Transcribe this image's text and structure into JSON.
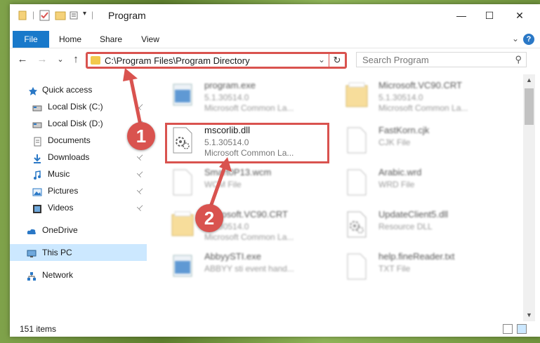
{
  "window": {
    "title": "Program",
    "minimize": "—",
    "maximize": "☐",
    "close": "✕"
  },
  "ribbon": {
    "tabs": [
      "File",
      "Home",
      "Share",
      "View"
    ],
    "help": "?",
    "collapse": "⌄"
  },
  "nav": {
    "back": "←",
    "forward": "→",
    "recent": "⌄",
    "up": "↑",
    "address": "C:\\Program Files\\Program Directory",
    "address_dropdown": "⌄",
    "refresh": "↻",
    "search_placeholder": "Search Program",
    "search_icon": "⚲"
  },
  "sidebar": {
    "items": [
      {
        "label": "Quick access",
        "icon": "star-icon",
        "pinned": false
      },
      {
        "label": "Local Disk (C:)",
        "icon": "drive-icon",
        "pinned": true
      },
      {
        "label": "Local Disk (D:)",
        "icon": "drive-icon",
        "pinned": true
      },
      {
        "label": "Documents",
        "icon": "documents-icon",
        "pinned": true
      },
      {
        "label": "Downloads",
        "icon": "download-icon",
        "pinned": true
      },
      {
        "label": "Music",
        "icon": "music-icon",
        "pinned": true
      },
      {
        "label": "Pictures",
        "icon": "pictures-icon",
        "pinned": true
      },
      {
        "label": "Videos",
        "icon": "videos-icon",
        "pinned": true
      },
      {
        "label": "OneDrive",
        "icon": "cloud-icon",
        "pinned": false
      },
      {
        "label": "This PC",
        "icon": "computer-icon",
        "pinned": false,
        "selected": true
      },
      {
        "label": "Network",
        "icon": "network-icon",
        "pinned": false
      }
    ],
    "pin_glyph": "📌"
  },
  "files": [
    {
      "name": "program.exe",
      "line2": "5.1.30514.0",
      "line3": "Microsoft Common La...",
      "icon": "exe-icon",
      "blurred": true
    },
    {
      "name": "Microsoft.VC90.CRT",
      "line2": "5.1.30514.0",
      "line3": "Microsoft Common La...",
      "icon": "folder-icon",
      "blurred": true
    },
    {
      "name": "mscorlib.dll",
      "line2": "5.1.30514.0",
      "line3": "Microsoft Common La...",
      "icon": "dll-gear-icon",
      "blurred": false
    },
    {
      "name": "FastKorn.cjk",
      "line2": "CJK File",
      "line3": "",
      "icon": "file-icon",
      "blurred": true
    },
    {
      "name": "Smart0P13.wcm",
      "line2": "WCM File",
      "line3": "",
      "icon": "file-icon",
      "blurred": true
    },
    {
      "name": "Arabic.wrd",
      "line2": "WRD File",
      "line3": "",
      "icon": "file-icon",
      "blurred": true
    },
    {
      "name": "Microsoft.VC90.CRT",
      "line2": "5.1.30514.0",
      "line3": "Microsoft Common La...",
      "icon": "folder-icon",
      "blurred": true
    },
    {
      "name": "UpdateClient5.dll",
      "line2": "Resource DLL",
      "line3": "",
      "icon": "dll-gear-icon",
      "blurred": true
    },
    {
      "name": "AbbyySTI.exe",
      "line2": "ABBYY sti event hand...",
      "line3": "",
      "icon": "exe-icon",
      "blurred": true
    },
    {
      "name": "help.fineReader.txt",
      "line2": "TXT File",
      "line3": "",
      "icon": "file-icon",
      "blurred": true
    }
  ],
  "status": {
    "items": "151 items"
  },
  "callouts": [
    "1",
    "2"
  ],
  "colors": {
    "accent": "#1979ca",
    "highlight": "#d9534f",
    "selected": "#cce8ff"
  }
}
